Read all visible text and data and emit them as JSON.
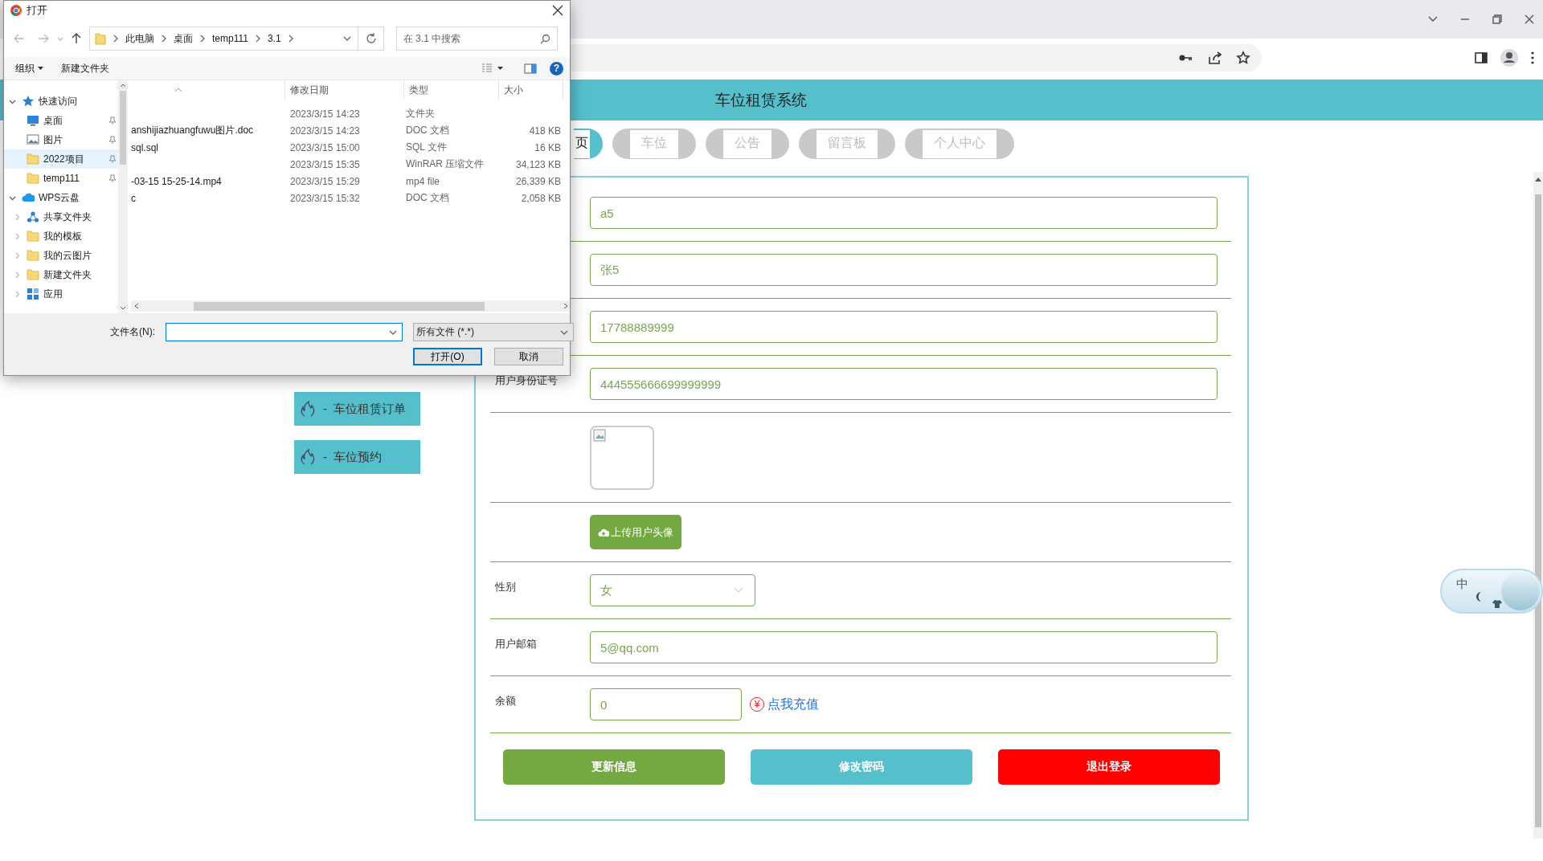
{
  "site": {
    "title": "车位租赁系统",
    "nav": [
      {
        "label": "页",
        "selected": true
      },
      {
        "label": "车位",
        "selected": false
      },
      {
        "label": "公告",
        "selected": false
      },
      {
        "label": "留言板",
        "selected": false
      },
      {
        "label": "个人中心",
        "selected": false
      }
    ],
    "sidebar": [
      {
        "marker": "-",
        "label": "车位租赁订单"
      },
      {
        "marker": "-",
        "label": "车位预约"
      }
    ],
    "form": {
      "rows": [
        {
          "kind": "text",
          "value": "a5"
        },
        {
          "kind": "text",
          "value": "张5"
        },
        {
          "kind": "text",
          "value": "17788889999"
        },
        {
          "kind": "text",
          "label": "用户身份证号",
          "value": "444555666699999999"
        },
        {
          "kind": "image"
        },
        {
          "kind": "upload",
          "button": "上传用户头像"
        },
        {
          "kind": "select",
          "label": "性别",
          "value": "女"
        },
        {
          "kind": "text",
          "label": "用户邮箱",
          "value": "5@qq.com"
        },
        {
          "kind": "balance",
          "label": "余额",
          "value": "0",
          "link_icon": "¥",
          "link": "点我充值"
        }
      ],
      "actions": [
        {
          "kind": "primary",
          "label": "更新信息"
        },
        {
          "kind": "info",
          "label": "修改密码"
        },
        {
          "kind": "danger",
          "label": "退出登录"
        }
      ]
    }
  },
  "ime_widget": {
    "label": "中"
  },
  "dialog": {
    "title": "打开",
    "breadcrumb": [
      "此电脑",
      "桌面",
      "temp111",
      "3.1"
    ],
    "search": {
      "placeholder": "在 3.1 中搜索"
    },
    "toolbar": {
      "organize": "组织",
      "new_folder": "新建文件夹",
      "help": "?"
    },
    "tree": [
      {
        "kind": "star",
        "label": "快速访问",
        "expanded": true,
        "selected": false,
        "children": [
          {
            "kind": "desktop",
            "label": "桌面",
            "pinned": true,
            "selected": false
          },
          {
            "kind": "pictures",
            "label": "图片",
            "pinned": true,
            "selected": false
          },
          {
            "kind": "folder",
            "label": "2022项目",
            "pinned": true,
            "selected": true
          },
          {
            "kind": "folder",
            "label": "temp111",
            "pinned": true,
            "selected": false
          }
        ]
      },
      {
        "kind": "cloud",
        "label": "WPS云盘",
        "expanded": true,
        "selected": false,
        "children": [
          {
            "kind": "share",
            "label": "共享文件夹",
            "expanded": false,
            "selected": false
          },
          {
            "kind": "folder",
            "label": "我的模板",
            "expanded": false,
            "selected": false
          },
          {
            "kind": "folder",
            "label": "我的云图片",
            "expanded": false,
            "selected": false
          },
          {
            "kind": "folder",
            "label": "新建文件夹",
            "expanded": false,
            "selected": false
          },
          {
            "kind": "apps",
            "label": "应用",
            "expanded": false,
            "selected": false
          }
        ]
      }
    ],
    "columns": [
      "修改日期",
      "类型",
      "大小"
    ],
    "files": [
      {
        "date": "2023/3/15 14:23",
        "type": "文件夹"
      },
      {
        "name": "anshijiazhuangfuwu图片.doc",
        "date": "2023/3/15 14:23",
        "type": "DOC 文档",
        "size": "418 KB"
      },
      {
        "name": "sql.sql",
        "date": "2023/3/15 15:00",
        "type": "SQL 文件",
        "size": "16 KB"
      },
      {
        "date": "2023/3/15 15:35",
        "type": "WinRAR 压缩文件",
        "size": "34,123 KB"
      },
      {
        "name": "-03-15 15-25-14.mp4",
        "date": "2023/3/15 15:29",
        "type": "mp4 file",
        "size": "26,339 KB"
      },
      {
        "name": "c",
        "date": "2023/3/15 15:32",
        "type": "DOC 文档",
        "size": "2,058 KB"
      }
    ],
    "filename_label": "文件名(N):",
    "filter": "所有文件 (*.*)",
    "buttons": [
      {
        "kind": "default",
        "label": "打开(O)"
      },
      {
        "kind": "normal",
        "label": "取消"
      }
    ]
  }
}
